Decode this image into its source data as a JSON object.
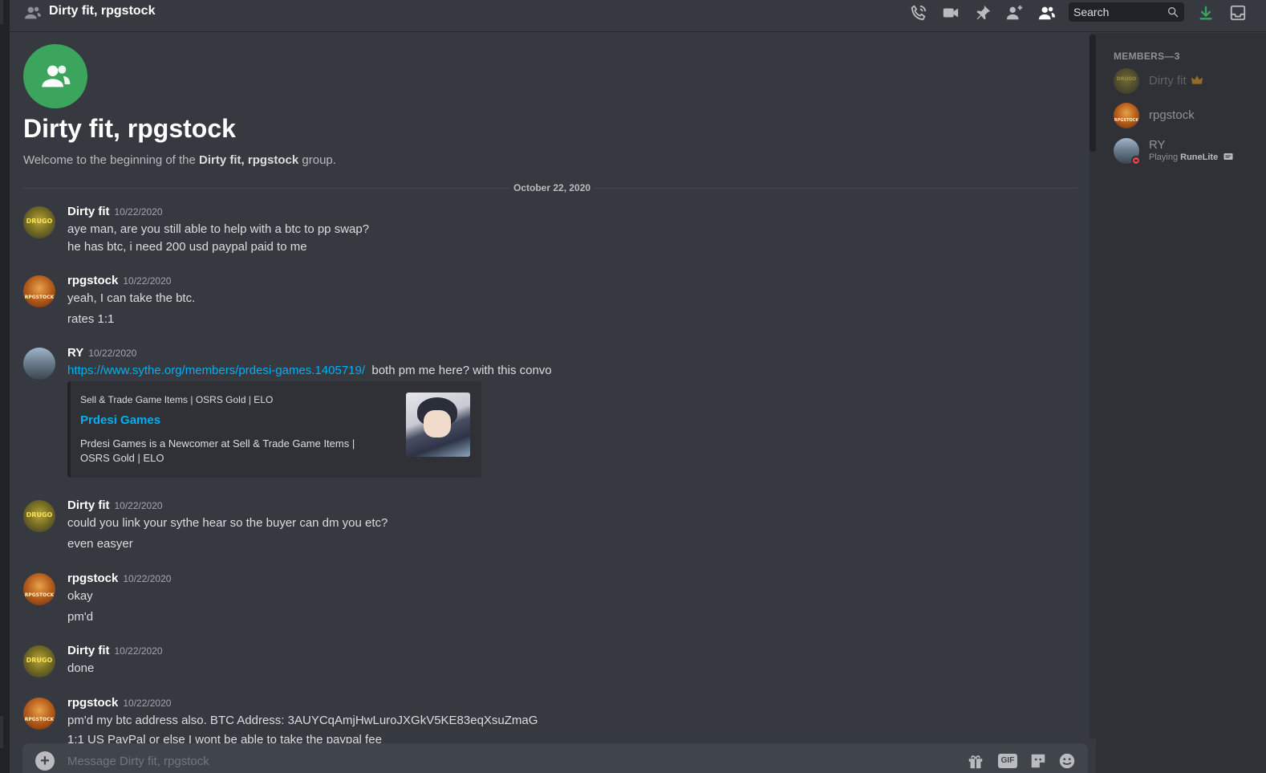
{
  "header": {
    "title": "Dirty fit, rpgstock",
    "search_placeholder": "Search"
  },
  "welcome": {
    "title": "Dirty fit, rpgstock",
    "prefix": "Welcome to the beginning of the ",
    "group_name": "Dirty fit, rpgstock",
    "suffix": " group."
  },
  "date_divider": "October 22, 2020",
  "messages": [
    {
      "author": "Dirty fit",
      "time": "10/22/2020",
      "lines": [
        "aye man, are you still able to help with a btc to pp swap?",
        "he has btc, i need 200 usd paypal paid to me"
      ]
    },
    {
      "author": "rpgstock",
      "time": "10/22/2020",
      "lines": [
        "yeah, I can take the btc.",
        "rates 1:1"
      ]
    },
    {
      "author": "RY",
      "time": "10/22/2020",
      "link": "https://www.sythe.org/members/prdesi-games.1405719/",
      "after_link": "both pm me here? with this convo",
      "embed": {
        "provider": "Sell & Trade Game Items | OSRS Gold | ELO",
        "title": "Prdesi Games",
        "description": "Prdesi Games is a Newcomer at Sell & Trade Game Items | OSRS Gold | ELO"
      }
    },
    {
      "author": "Dirty fit",
      "time": "10/22/2020",
      "lines": [
        "could you link your sythe hear so the buyer can dm you etc?",
        "even easyer"
      ]
    },
    {
      "author": "rpgstock",
      "time": "10/22/2020",
      "lines": [
        "okay",
        "pm'd"
      ]
    },
    {
      "author": "Dirty fit",
      "time": "10/22/2020",
      "lines": [
        "done"
      ]
    },
    {
      "author": "rpgstock",
      "time": "10/22/2020",
      "lines": [
        "pm'd my btc address also. BTC Address: 3AUYCqAmjHwLuroJXGkV5KE83eqXsuZmaG",
        "1:1 US PayPal or else I wont be able to take the paypal fee"
      ]
    }
  ],
  "avatars": {
    "dirty": "DRUGO",
    "rpg": "RPGSTOCK"
  },
  "composer": {
    "placeholder": "Message Dirty fit, rpgstock",
    "gif_label": "GIF"
  },
  "members": {
    "header": "MEMBERS—3",
    "list": [
      {
        "name": "Dirty fit",
        "owner": true
      },
      {
        "name": "rpgstock"
      },
      {
        "name": "RY",
        "status_prefix": "Playing ",
        "status_game": "RuneLite"
      }
    ]
  },
  "colors": {
    "accent_green": "#3ba55d",
    "link": "#00b0f4",
    "dnd": "#ed4245",
    "owner_crown": "#faa81a",
    "download": "#3ba55d"
  }
}
